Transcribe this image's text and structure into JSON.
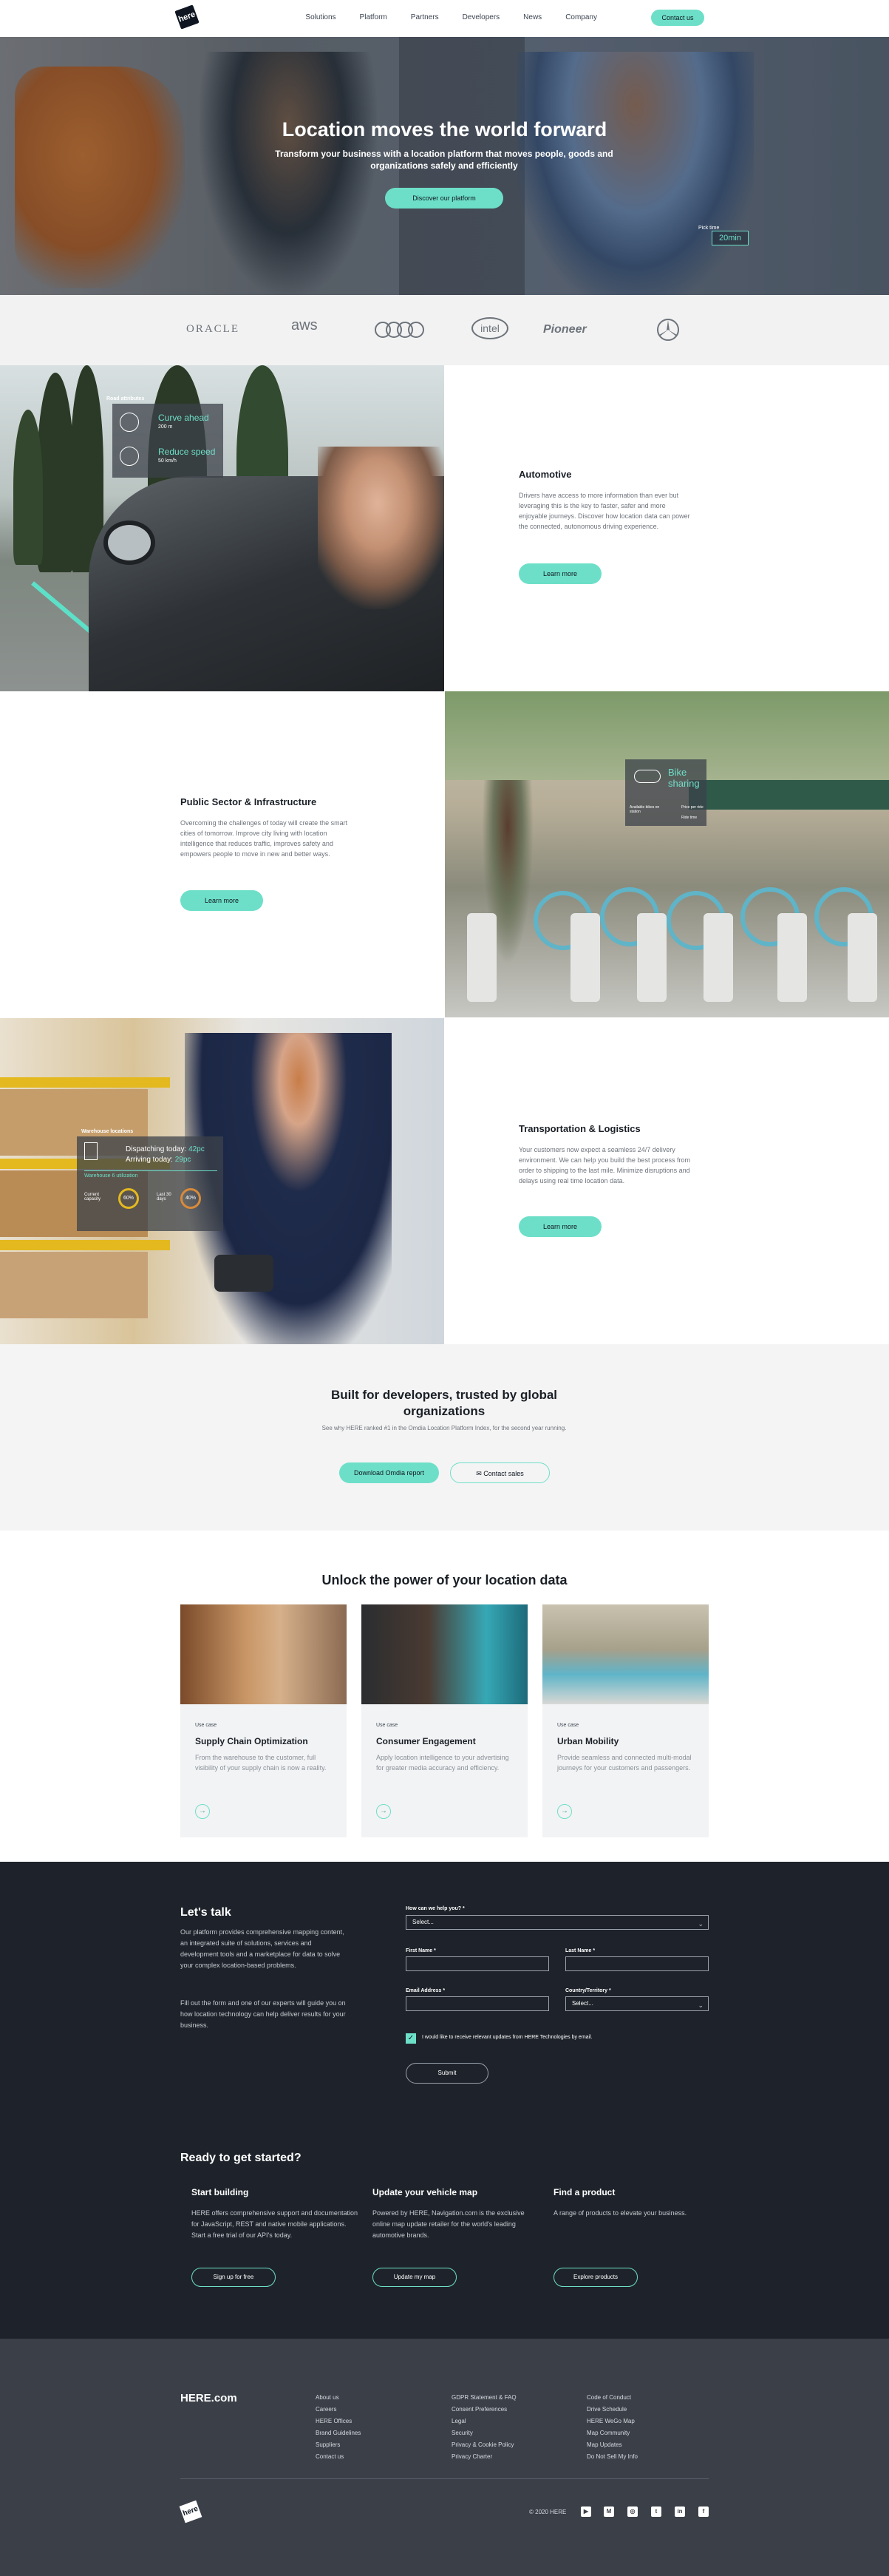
{
  "brand": {
    "logo_text": "here",
    "accent": "#6ddfc8"
  },
  "nav": {
    "items": [
      "Solutions",
      "Platform",
      "Partners",
      "Developers",
      "News",
      "Company"
    ],
    "cta": "Contact us"
  },
  "hero": {
    "title": "Location moves the world forward",
    "subtitle": "Transform your business with a location platform that moves people, goods and organizations safely and efficiently",
    "cta": "Discover our platform",
    "tag_label": "Pick time",
    "tag_time": "20min"
  },
  "partners": [
    "ORACLE",
    "aws",
    "Audi",
    "intel",
    "Pioneer",
    "Mercedes-Benz"
  ],
  "automotive": {
    "title": "Automotive",
    "body": "Drivers have access to more information than ever but leveraging this is the key to faster, safer and more enjoyable journeys. Discover how location data can power the connected, autonomous driving experience.",
    "cta": "Learn more",
    "overlay": {
      "header": "Road attributes",
      "row1_title": "Curve ahead",
      "row1_value": "200 m",
      "row2_title": "Reduce speed",
      "row2_value": "50 km/h"
    }
  },
  "public_sector": {
    "title": "Public Sector & Infrastructure",
    "body": "Overcoming the challenges of today will create the smart cities of tomorrow. Improve city living with location intelligence that reduces traffic, improves safety and empowers people to move in new and better ways.",
    "cta": "Learn more",
    "overlay": {
      "title": "Bike sharing",
      "line1": "Available bikes on station",
      "line2": "Price per ride",
      "line3": "Ride time"
    }
  },
  "logistics": {
    "title": "Transportation & Logistics",
    "body": "Your customers now expect a seamless 24/7 delivery environment. We can help you build the best process from order to shipping to the last mile. Minimize disruptions and delays using real time location data.",
    "cta": "Learn more",
    "overlay": {
      "header": "Warehouse locations",
      "line1": "Dispatching today: ",
      "line1_value": "42pc",
      "line2": "Arriving today: ",
      "line2_value": "29pc",
      "sub_header": "Warehouse 6 utilization",
      "g1_label": "Current capacity",
      "g1_value": "60%",
      "g2_label": "Last 30 days",
      "g2_value": "40%"
    }
  },
  "developers": {
    "title": "Built for developers, trusted by global organizations",
    "body": "See why HERE ranked #1 in the Omdia Location Platform Index, for the second year running.",
    "primary": "Download Omdia report",
    "secondary": "Contact sales"
  },
  "unlock": {
    "title": "Unlock the power of your location data",
    "cards": [
      {
        "tag": "Use case",
        "title": "Supply Chain Optimization",
        "body": "From the warehouse to the customer, full visibility of your supply chain is now a reality."
      },
      {
        "tag": "Use case",
        "title": "Consumer Engagement",
        "body": "Apply location intelligence to your advertising for greater media accuracy and efficiency."
      },
      {
        "tag": "Use case",
        "title": "Urban Mobility",
        "body": "Provide seamless and connected multi-modal journeys for your customers and passengers."
      }
    ]
  },
  "talk": {
    "title": "Let's talk",
    "body1": "Our platform provides comprehensive mapping content, an integrated suite of solutions, services and development tools and a marketplace for data to solve your complex location-based problems.",
    "body2": "Fill out the form and one of our experts will guide you on how location technology can help deliver results for your business.",
    "form": {
      "help_label": "How can we help you? *",
      "help_value": "Select...",
      "first_label": "First Name *",
      "last_label": "Last Name *",
      "email_label": "Email Address *",
      "country_label": "Country/Territory *",
      "country_value": "Select...",
      "consent": "I would like to receive relevant updates from HERE Technologies by email.",
      "submit": "Submit"
    }
  },
  "ready": {
    "title": "Ready to get started?",
    "cols": [
      {
        "title": "Start building",
        "body": "HERE offers comprehensive support and documentation for JavaScript, REST and native mobile applications. Start a free trial of our API's today.",
        "cta": "Sign up for free"
      },
      {
        "title": "Update your vehicle map",
        "body": "Powered by HERE, Navigation.com is the exclusive online map update retailer for the world's leading automotive brands.",
        "cta": "Update my map"
      },
      {
        "title": "Find a product",
        "body": "A range of products to elevate your business.",
        "cta": "Explore products"
      }
    ]
  },
  "footer": {
    "brand": "HERE.com",
    "col1": [
      "About us",
      "Careers",
      "HERE Offices",
      "Brand Guidelines",
      "Suppliers",
      "Contact us"
    ],
    "col2": [
      "GDPR Statement & FAQ",
      "Consent Preferences",
      "Legal",
      "Security",
      "Privacy & Cookie Policy",
      "Privacy Charter"
    ],
    "col3": [
      "Code of Conduct",
      "Drive Schedule",
      "HERE WeGo Map",
      "Map Community",
      "Map Updates",
      "Do Not Sell My Info"
    ],
    "copyright": "© 2020 HERE",
    "social": [
      "youtube-icon",
      "medium-icon",
      "instagram-icon",
      "twitter-icon",
      "linkedin-icon",
      "facebook-icon"
    ]
  }
}
